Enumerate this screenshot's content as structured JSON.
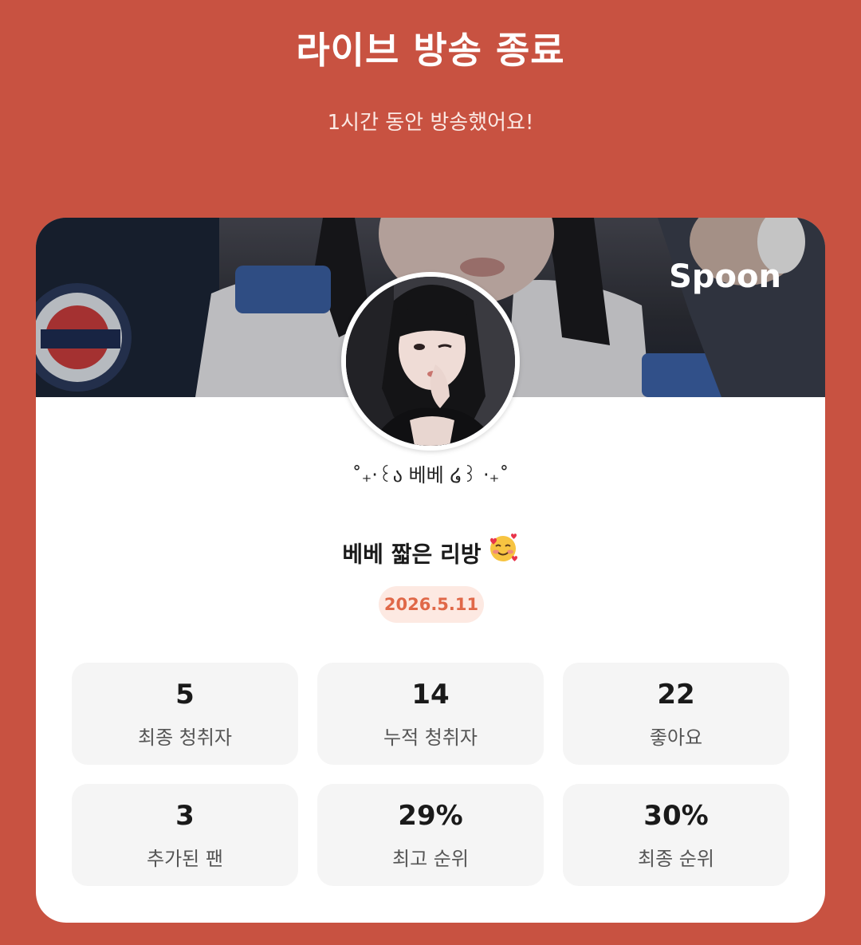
{
  "header": {
    "title": "라이브 방송 종료",
    "subtitle": "1시간 동안 방송했어요!"
  },
  "card": {
    "brand": "Spoon",
    "nickname": "˚₊‧꒰ა 베베 ໒꒱ ‧₊˚",
    "live_title": "베베 짧은 리방",
    "live_title_emoji": "smiling-face-with-hearts-icon",
    "date": "2026.5.11"
  },
  "stats": [
    {
      "value": "5",
      "label": "최종 청취자"
    },
    {
      "value": "14",
      "label": "누적 청취자"
    },
    {
      "value": "22",
      "label": "좋아요"
    },
    {
      "value": "3",
      "label": "추가된 팬"
    },
    {
      "value": "29%",
      "label": "최고 순위"
    },
    {
      "value": "30%",
      "label": "최종 순위"
    }
  ],
  "colors": {
    "background": "#c85241",
    "card": "#ffffff",
    "stat_card": "#f5f5f5",
    "date_badge_bg": "#fde9e2",
    "date_badge_text": "#e06848"
  }
}
